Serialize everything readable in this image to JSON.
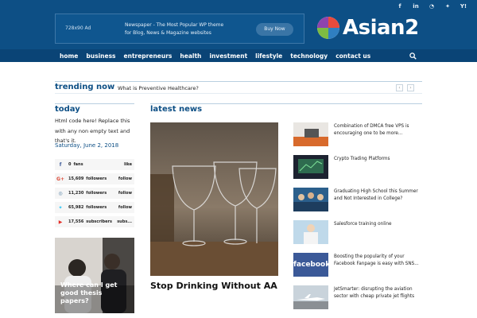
{
  "header": {
    "social_icons": [
      {
        "icon": "facebook-icon",
        "glyph": "f"
      },
      {
        "icon": "linkedin-icon",
        "glyph": "in"
      },
      {
        "icon": "rss-icon",
        "glyph": "◔"
      },
      {
        "icon": "twitter-icon",
        "glyph": "✦"
      },
      {
        "icon": "yahoo-icon",
        "glyph": "Y!"
      }
    ],
    "ad": {
      "size_label": "728x90 Ad",
      "line1": "Newspaper - The Most Popular WP theme",
      "line2": "for Blog, News & Magazine websites",
      "button_label": "Buy Now"
    },
    "logo_text": "Asian2"
  },
  "nav": {
    "items": [
      "home",
      "business",
      "entrepreneurs",
      "health",
      "investment",
      "lifestyle",
      "technology",
      "contact us"
    ],
    "search_icon": "search-icon"
  },
  "trending": {
    "label": "trending now",
    "headline": "What is Preventive Healthcare?",
    "prev": "‹",
    "next": "›"
  },
  "today": {
    "title": "today",
    "text": "Html code here! Replace this with any non empty text and that's it.",
    "date": "Saturday, June 2, 2018"
  },
  "social_counters": [
    {
      "icon": "facebook-icon",
      "glyph": "f",
      "color": "#3b5998",
      "count": "0",
      "label": "fans",
      "action": "like"
    },
    {
      "icon": "google-plus-icon",
      "glyph": "G+",
      "color": "#dd4b39",
      "count": "15,609",
      "label": "followers",
      "action": "follow"
    },
    {
      "icon": "instagram-icon",
      "glyph": "◎",
      "color": "#517fa4",
      "count": "11,230",
      "label": "followers",
      "action": "follow"
    },
    {
      "icon": "twitter-icon",
      "glyph": "✦",
      "color": "#29c5f6",
      "count": "65,982",
      "label": "followers",
      "action": "follow"
    },
    {
      "icon": "youtube-icon",
      "glyph": "▶",
      "color": "#e52d27",
      "count": "17,556",
      "label": "subscribers",
      "action": "subs..."
    }
  ],
  "thesis": {
    "caption": "Where can I get good thesis papers?"
  },
  "latest": {
    "title": "latest news",
    "hero_title": "Stop Drinking Without AA",
    "items": [
      "Combination of DMCA free VPS is encouraging one to be more...",
      "Crypto Trading Platforms",
      "Graduating High School this Summer and Not Interested in College?",
      "Salesforce training online",
      "Boosting the popularity of your Facebook Fanpage is easy with SNS...",
      "JetSmarter: disrupting the aviation sector with cheap private jet flights"
    ],
    "facebook_thumb_text": "facebook"
  },
  "colors": {
    "header_bg": "#0d4f85",
    "accent": "#0d4f85"
  }
}
